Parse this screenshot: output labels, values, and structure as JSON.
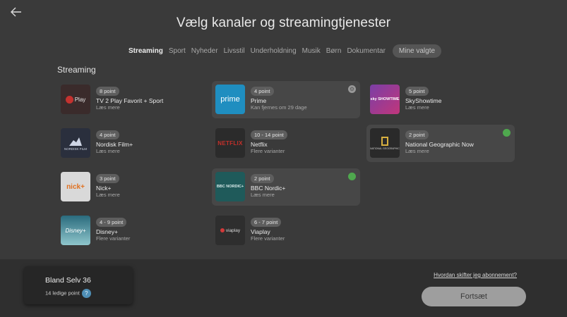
{
  "header": {
    "back_icon": "arrow-left-icon",
    "title": "Vælg kanaler og streamingtjenester"
  },
  "tabs": [
    {
      "label": "Streaming",
      "active": true
    },
    {
      "label": "Sport"
    },
    {
      "label": "Nyheder"
    },
    {
      "label": "Livsstil"
    },
    {
      "label": "Underholdning"
    },
    {
      "label": "Musik"
    },
    {
      "label": "Børn"
    },
    {
      "label": "Dokumentar"
    }
  ],
  "selected_tab_pill": "Mine valgte",
  "section": {
    "title": "Streaming"
  },
  "services": [
    {
      "name": "TV 2 Play Favorit + Sport",
      "points": "8 point",
      "sub": "Læs mere",
      "logo_text": "Play",
      "selected": false
    },
    {
      "name": "Prime",
      "points": "4 point",
      "sub": "Kan fjernes om 29 dage",
      "logo_text": "prime",
      "selected": true,
      "locked": true
    },
    {
      "name": "SkyShowtime",
      "points": "5 point",
      "sub": "Læs mere",
      "logo_text": "sky SHOWTIME",
      "selected": false
    },
    {
      "name": "Nordisk Film+",
      "points": "4 point",
      "sub": "Læs mere",
      "logo_text": "NORDISK FILM",
      "selected": false
    },
    {
      "name": "Netflix",
      "points": "10 - 14 point",
      "sub": "Flere varianter",
      "logo_text": "NETFLIX",
      "selected": false
    },
    {
      "name": "National Geographic Now",
      "points": "2 point",
      "sub": "Læs mere",
      "logo_text": "NATIONAL GEOGRAPHIC",
      "selected": true
    },
    {
      "name": "Nick+",
      "points": "3 point",
      "sub": "Læs mere",
      "logo_text": "nick+",
      "selected": false
    },
    {
      "name": "BBC Nordic+",
      "points": "2 point",
      "sub": "Læs mere",
      "logo_text": "BBC NORDIC+",
      "selected": true
    },
    {
      "name": "Disney+",
      "points": "4 - 9 point",
      "sub": "Flere varianter",
      "logo_text": "Disney+",
      "selected": false
    },
    {
      "name": "Viaplay",
      "points": "6 - 7 point",
      "sub": "Flere varianter",
      "logo_text": "viaplay",
      "selected": false
    }
  ],
  "plan": {
    "name": "Bland Selv 36",
    "points_left": "14 ledige point",
    "help_glyph": "?"
  },
  "footer": {
    "how_link": "Hvordan skifter jeg abonnement?",
    "continue_label": "Fortsæt"
  },
  "colors": {
    "background": "#3a3a3a",
    "selected_check": "#4fa84e",
    "help_dot": "#4f8fb6"
  }
}
